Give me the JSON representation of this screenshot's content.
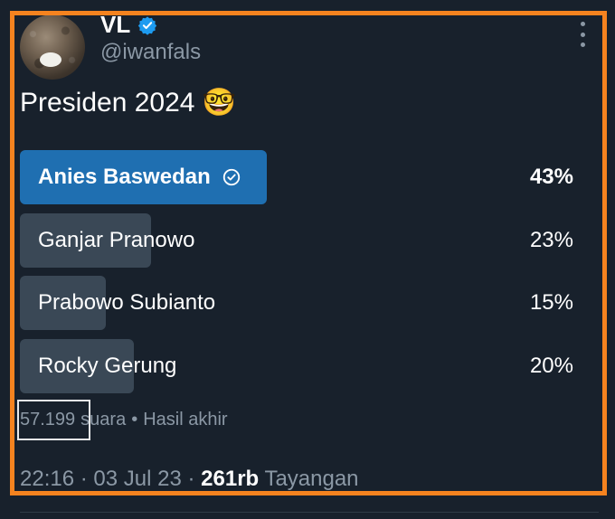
{
  "author": {
    "display_name": "VL",
    "handle": "@iwanfals",
    "verified": true
  },
  "tweet": {
    "text": "Presiden 2024 🤓"
  },
  "poll": {
    "options": [
      {
        "label": "Anies Baswedan",
        "percent_text": "43%",
        "percent": 43,
        "winner": true
      },
      {
        "label": "Ganjar Pranowo",
        "percent_text": "23%",
        "percent": 23,
        "winner": false
      },
      {
        "label": "Prabowo Subianto",
        "percent_text": "15%",
        "percent": 15,
        "winner": false
      },
      {
        "label": "Rocky Gerung",
        "percent_text": "20%",
        "percent": 20,
        "winner": false
      }
    ],
    "votes": "57.199",
    "votes_suffix": "suara",
    "separator": "•",
    "status": "Hasil akhir"
  },
  "meta": {
    "time": "22:16",
    "sep1": "·",
    "date": "03 Jul 23",
    "sep2": "·",
    "views": "261rb",
    "views_label": "Tayangan"
  },
  "colors": {
    "background": "#18212c",
    "winner_bar": "#1f6fb1",
    "other_bar": "#3a4856",
    "highlight_border": "#f5831f",
    "muted_text": "#8b98a5",
    "verified_badge": "#1d9bf0"
  },
  "icons": {
    "verified": "verified-badge-icon",
    "check": "check-circle-icon",
    "more": "more-vertical-icon",
    "emoji": "nerd-face-emoji"
  }
}
